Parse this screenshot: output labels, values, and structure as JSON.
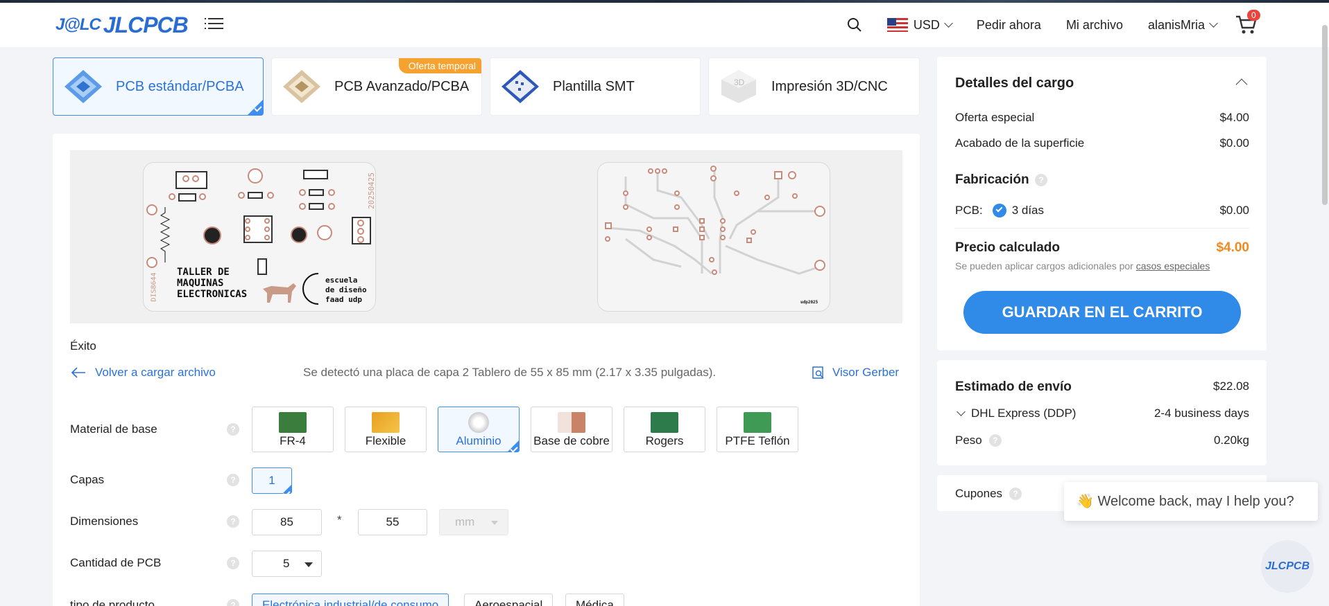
{
  "header": {
    "logo_mark": "J@LC",
    "logo_name": "JLCPCB",
    "currency": "USD",
    "nav_order": "Pedir ahora",
    "nav_file": "Mi archivo",
    "username": "alanisMria",
    "cart_count": "0"
  },
  "product_tabs": [
    {
      "label": "PCB estándar/PCBA",
      "active": true
    },
    {
      "label": "PCB Avanzado/PCBA",
      "badge": "Oferta temporal"
    },
    {
      "label": "Plantilla SMT"
    },
    {
      "label": "Impresión 3D/CNC"
    }
  ],
  "preview": {
    "silk_title_1": "TALLER DE",
    "silk_title_2": "MAQUINAS",
    "silk_title_3": "ELECTRONICAS",
    "silk_school_1": "escuela",
    "silk_school_2": "de diseño",
    "silk_school_3": "faad udp",
    "silk_code": "DIS8644",
    "silk_date": "20250425",
    "silk_back": "udp2025"
  },
  "upload": {
    "status": "Éxito",
    "reupload_label": "Volver a cargar archivo",
    "detect_text": "Se detectó una placa de capa 2 Tablero de 55 x 85 mm (2.17 x 3.35 pulgadas).",
    "gerber_label": "Visor Gerber"
  },
  "form": {
    "material_label": "Material de base",
    "materials": [
      "FR-4",
      "Flexible",
      "Aluminio",
      "Base de cobre",
      "Rogers",
      "PTFE Teflón"
    ],
    "material_selected": "Aluminio",
    "layers_label": "Capas",
    "layers_value": "1",
    "dimensions_label": "Dimensiones",
    "dim_width": "85",
    "dim_times": "*",
    "dim_height": "55",
    "dim_unit": "mm",
    "qty_label": "Cantidad de PCB",
    "qty_value": "5",
    "product_type_label": "tipo de producto",
    "product_types": [
      "Electrónica industrial/de consumo",
      "Aeroespacial",
      "Médica"
    ]
  },
  "charges": {
    "title": "Detalles del cargo",
    "special_label": "Oferta especial",
    "special_value": "$4.00",
    "finish_label": "Acabado de la superficie",
    "finish_value": "$0.00",
    "fab_title": "Fabricación",
    "pcb_label": "PCB:",
    "pcb_days": "3 días",
    "pcb_value": "$0.00",
    "calc_label": "Precio calculado",
    "calc_value": "$4.00",
    "note_prefix": "Se pueden aplicar cargos adicionales por",
    "note_link": "casos especiales",
    "cta": "GUARDAR EN EL CARRITO"
  },
  "shipping": {
    "title": "Estimado de envío",
    "price": "$22.08",
    "carrier": "DHL Express (DDP)",
    "days": "2-4 business days",
    "weight_label": "Peso",
    "weight_value": "0.20kg"
  },
  "coupons": {
    "label": "Cupones"
  },
  "chat": {
    "message": "Welcome back, may I help you?",
    "button": "JLCPCB"
  },
  "colors": {
    "accent": "#2f8ae8",
    "price": "#f08a1c",
    "badge": "#f6a230"
  }
}
